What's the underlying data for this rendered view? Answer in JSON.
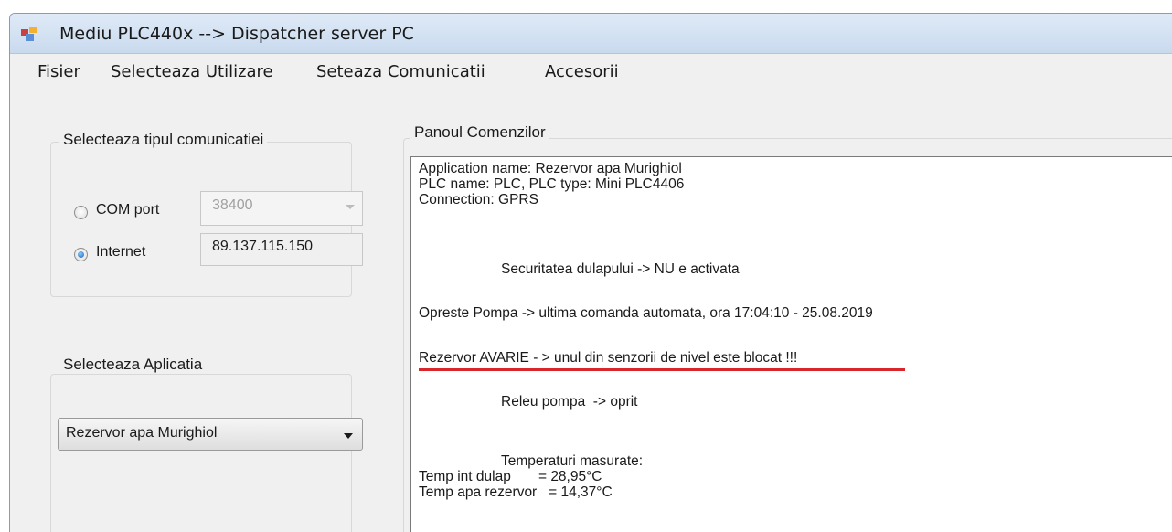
{
  "window": {
    "title": "Mediu PLC440x --> Dispatcher server PC"
  },
  "menu": [
    "Fisier",
    "Selecteaza Utilizare",
    "Seteaza Comunicatii",
    "Accesorii"
  ],
  "comm_group": {
    "title": "Selecteaza tipul comunicatiei",
    "com_port": {
      "label": "COM port",
      "selected": false,
      "baud_value": "38400"
    },
    "internet": {
      "label": "Internet",
      "selected": true,
      "ip_value": "89.137.115.150"
    }
  },
  "app_group": {
    "title": "Selecteaza Aplicatia",
    "selected_app": "Rezervor apa Murighiol"
  },
  "command_panel": {
    "title": "Panoul Comenzilor",
    "lines": [
      "Application name: Rezervor apa Murighiol",
      "PLC name: PLC, PLC type: Mini PLC4406",
      "Connection: GPRS",
      "Securitatea dulapului -> NU e activata",
      "Opreste Pompa -> ultima comanda automata, ora 17:04:10 - 25.08.2019",
      "Rezervor AVARIE - > unul din senzorii de nivel este blocat !!!",
      "Releu pompa  -> oprit",
      "Temperaturi masurate:",
      "Temp int dulap       = 28,95°C",
      "Temp apa rezervor   = 14,37°C"
    ],
    "alert_underline_color": "#d8262b"
  }
}
